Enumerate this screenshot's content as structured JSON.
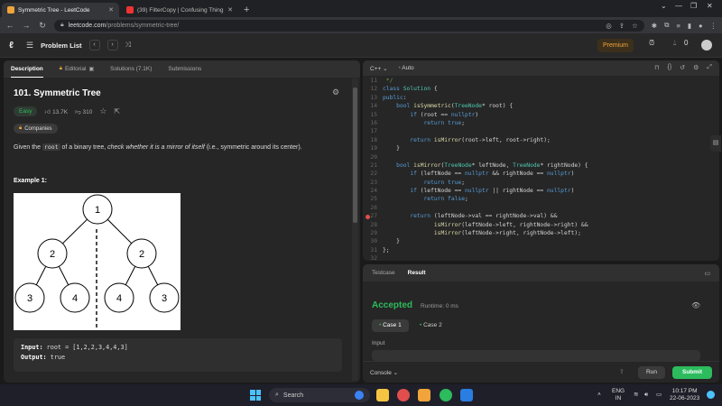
{
  "browser": {
    "tabs": [
      {
        "title": "Symmetric Tree - LeetCode",
        "color": "#f0a43a"
      },
      {
        "title": "(39) FilterCopy | Confusing Thing",
        "color": "#e33"
      }
    ],
    "url_host": "leetcode.com",
    "url_path": "/problems/symmetric-tree/"
  },
  "header": {
    "problem_list": "Problem List",
    "premium": "Premium",
    "coins": "0"
  },
  "left": {
    "tabs": {
      "description": "Description",
      "editorial": "Editorial",
      "solutions": "Solutions (7.1K)",
      "submissions": "Submissions"
    },
    "title": "101. Symmetric Tree",
    "difficulty": "Easy",
    "likes": "13.7K",
    "dislikes": "310",
    "companies": "Companies",
    "desc_prefix": "Given the ",
    "desc_code": "root",
    "desc_mid": " of a binary tree, ",
    "desc_em": "check whether it is a mirror of itself",
    "desc_suffix": " (i.e., symmetric around its center).",
    "example_title": "Example 1:",
    "tree_nodes": [
      "1",
      "2",
      "2",
      "3",
      "4",
      "4",
      "3"
    ],
    "input_label": "Input:",
    "input_value": " root = [1,2,2,3,4,4,3]",
    "output_label": "Output:",
    "output_value": " true"
  },
  "code": {
    "language": "C++",
    "mode": "Auto",
    "lines": [
      {
        "n": "11",
        "t": [
          [
            "cm",
            " */"
          ]
        ]
      },
      {
        "n": "12",
        "t": [
          [
            "kw",
            "class "
          ],
          [
            "ty",
            "Solution"
          ],
          [
            "tx",
            " {"
          ]
        ]
      },
      {
        "n": "13",
        "t": [
          [
            "kw",
            "public"
          ],
          [
            "tx",
            ":"
          ]
        ]
      },
      {
        "n": "14",
        "t": [
          [
            "tx",
            "    "
          ],
          [
            "kw",
            "bool "
          ],
          [
            "fn",
            "isSymmetric"
          ],
          [
            "tx",
            "("
          ],
          [
            "ty",
            "TreeNode"
          ],
          [
            "tx",
            "* root) {"
          ]
        ]
      },
      {
        "n": "15",
        "t": [
          [
            "tx",
            "        "
          ],
          [
            "kw",
            "if"
          ],
          [
            "tx",
            " (root == "
          ],
          [
            "kw",
            "nullptr"
          ],
          [
            "tx",
            ")"
          ]
        ]
      },
      {
        "n": "16",
        "t": [
          [
            "tx",
            "            "
          ],
          [
            "kw",
            "return true"
          ],
          [
            "tx",
            ";"
          ]
        ]
      },
      {
        "n": "17",
        "t": [
          [
            "tx",
            ""
          ]
        ]
      },
      {
        "n": "18",
        "t": [
          [
            "tx",
            "        "
          ],
          [
            "kw",
            "return "
          ],
          [
            "fn",
            "isMirror"
          ],
          [
            "tx",
            "(root->left, root->right);"
          ]
        ]
      },
      {
        "n": "19",
        "t": [
          [
            "tx",
            "    }"
          ]
        ]
      },
      {
        "n": "20",
        "t": [
          [
            "tx",
            ""
          ]
        ]
      },
      {
        "n": "21",
        "t": [
          [
            "tx",
            "    "
          ],
          [
            "kw",
            "bool "
          ],
          [
            "fn",
            "isMirror"
          ],
          [
            "tx",
            "("
          ],
          [
            "ty",
            "TreeNode"
          ],
          [
            "tx",
            "* leftNode, "
          ],
          [
            "ty",
            "TreeNode"
          ],
          [
            "tx",
            "* rightNode) {"
          ]
        ]
      },
      {
        "n": "22",
        "t": [
          [
            "tx",
            "        "
          ],
          [
            "kw",
            "if"
          ],
          [
            "tx",
            " (leftNode == "
          ],
          [
            "kw",
            "nullptr"
          ],
          [
            "tx",
            " && rightNode == "
          ],
          [
            "kw",
            "nullptr"
          ],
          [
            "tx",
            ")"
          ]
        ]
      },
      {
        "n": "23",
        "t": [
          [
            "tx",
            "            "
          ],
          [
            "kw",
            "return true"
          ],
          [
            "tx",
            ";"
          ]
        ]
      },
      {
        "n": "24",
        "t": [
          [
            "tx",
            "        "
          ],
          [
            "kw",
            "if"
          ],
          [
            "tx",
            " (leftNode == "
          ],
          [
            "kw",
            "nullptr"
          ],
          [
            "tx",
            " || rightNode == "
          ],
          [
            "kw",
            "nullptr"
          ],
          [
            "tx",
            ")"
          ]
        ]
      },
      {
        "n": "25",
        "t": [
          [
            "tx",
            "            "
          ],
          [
            "kw",
            "return false"
          ],
          [
            "tx",
            ";"
          ]
        ]
      },
      {
        "n": "26",
        "t": [
          [
            "tx",
            ""
          ]
        ]
      },
      {
        "n": "27",
        "t": [
          [
            "tx",
            "        "
          ],
          [
            "kw",
            "return"
          ],
          [
            "tx",
            " (leftNode->val == rightNode->val) &&"
          ]
        ]
      },
      {
        "n": "28",
        "t": [
          [
            "tx",
            "               "
          ],
          [
            "fn",
            "isMirror"
          ],
          [
            "tx",
            "(leftNode->left, rightNode->right) &&"
          ]
        ]
      },
      {
        "n": "29",
        "t": [
          [
            "tx",
            "               "
          ],
          [
            "fn",
            "isMirror"
          ],
          [
            "tx",
            "(leftNode->right, rightNode->left);"
          ]
        ]
      },
      {
        "n": "30",
        "t": [
          [
            "tx",
            "    }"
          ]
        ]
      },
      {
        "n": "31",
        "t": [
          [
            "tx",
            "};"
          ]
        ]
      },
      {
        "n": "32",
        "t": [
          [
            "tx",
            ""
          ]
        ]
      }
    ],
    "breakpoint_line": "27"
  },
  "test": {
    "tab_testcase": "Testcase",
    "tab_result": "Result",
    "accepted": "Accepted",
    "runtime": "Runtime: 0 ms",
    "case1": "Case 1",
    "case2": "Case 2",
    "input_label": "Input",
    "console": "Console",
    "run": "Run",
    "submit": "Submit"
  },
  "taskbar": {
    "search": "Search",
    "lang": "ENG",
    "region": "IN",
    "time": "10:17 PM",
    "date": "22-06-2023"
  }
}
